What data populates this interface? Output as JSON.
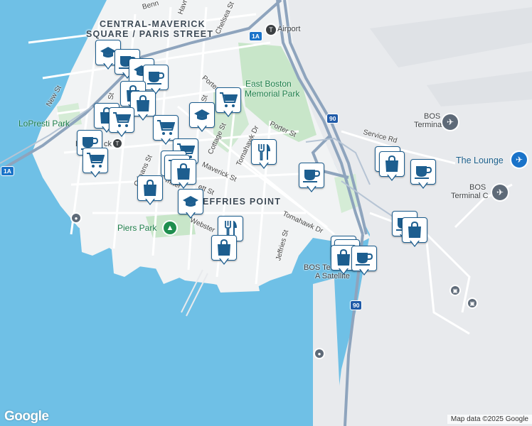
{
  "map": {
    "area_labels": {
      "central_maverick_line1": "CENTRAL-MAVERICK",
      "central_maverick_line2": "SQUARE / PARIS STREET",
      "jeffries_point": "EFFRIES POINT"
    },
    "streets": {
      "bennington": "Benn",
      "havre": "Havre",
      "chelsea": "Chelsea St",
      "new": "New St",
      "porter_a": "Porter",
      "porter_b": "Porter St",
      "meridian": "Meridian St",
      "maverick": "Maverick St",
      "cottage": "Cottage St",
      "tomahawk_a": "Tomahawk Dr",
      "tomahawk_b": "Tomahawk Dr",
      "orleans_a": "eans St",
      "orleans_b": "Orleans St",
      "everett": "ett St",
      "sumner": "mner",
      "webster": "Webster",
      "jeffries": "Jeffries St",
      "service_rd": "Service Rd",
      "st_frag": "St"
    },
    "parks": {
      "east_boston_line1": "East Boston",
      "east_boston_line2": "Memorial Park",
      "lopresti": "LoPresti Park",
      "piers": "Piers Park"
    },
    "places": {
      "airport": "Airport",
      "maverick_station": "M",
      "maverick_station_tail": "ck",
      "bos_terminal_e_line1": "BOS",
      "bos_terminal_e_line2": "Terminal E",
      "bos_terminal_c_line1": "BOS",
      "bos_terminal_c_line2": "Terminal C",
      "the_lounge": "The Lounge",
      "bos_satellite_line1": "BOS Te",
      "bos_satellite_line2": "A Satellite"
    },
    "routes": {
      "r1a_top": "1A",
      "r1a_left": "1A",
      "i90_top": "90",
      "i90_bottom": "90"
    },
    "attribution": {
      "logo": "Google",
      "copyright": "Map data ©2025 Google"
    },
    "marker_types": [
      "school",
      "coffee",
      "shopping-bag",
      "grocery-cart",
      "restaurant"
    ],
    "colors": {
      "water": "#6fc0e6",
      "land": "#f1f3f4",
      "airport_land": "#e8eaed",
      "park": "#c8e6c9",
      "highway": "#8ea4bd",
      "marker_accent": "#1d5e8f"
    }
  }
}
